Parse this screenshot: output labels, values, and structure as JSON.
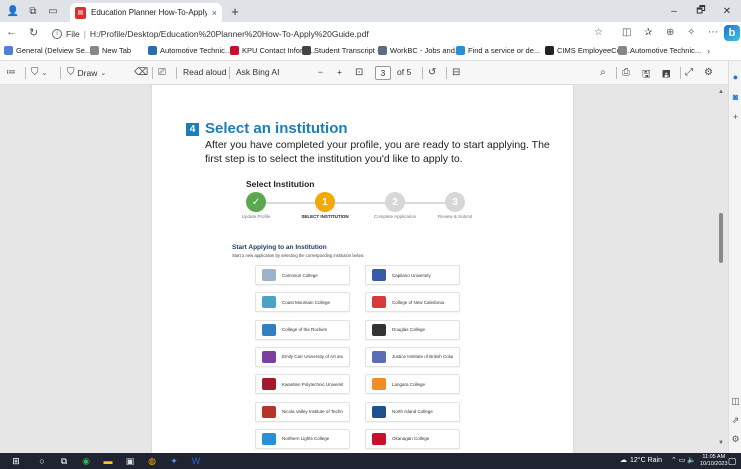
{
  "tab": {
    "title": "Education Planner How-To-Apply",
    "close": "×",
    "new": "+"
  },
  "window": {
    "minimize": "–",
    "restore": "🗗",
    "close": "✕"
  },
  "address": {
    "file_label": "File",
    "url": "H:/Profile/Desktop/Education%20Planner%20How-To-Apply%20Guide.pdf"
  },
  "favorites": [
    {
      "label": "General (Delview Se...",
      "color": "#4f7fd9"
    },
    {
      "label": "New Tab",
      "color": "#888888"
    },
    {
      "label": "Automotive Technic...",
      "color": "#2b6cb0"
    },
    {
      "label": "KPU Contact Inform...",
      "color": "#c8102e"
    },
    {
      "label": "Student Transcript -...",
      "color": "#444444"
    },
    {
      "label": "WorkBC - Jobs and...",
      "color": "#5a6d85"
    },
    {
      "label": "Find a service or de...",
      "color": "#2b8fd6"
    },
    {
      "label": "CIMS EmployeeCon...",
      "color": "#222222"
    },
    {
      "label": "Automotive Technic...",
      "color": "#888888"
    }
  ],
  "pdf_toolbar": {
    "draw": "Draw",
    "read_aloud": "Read aloud",
    "ask_bing": "Ask Bing AI",
    "zoom_out": "−",
    "zoom_in": "+",
    "page_current": "3",
    "page_of": "of 5"
  },
  "document": {
    "step_number": "4",
    "step_title": "Select an institution",
    "step_body": "After you have completed your profile, you are ready to start applying. The first step is to select the institution you'd like to apply to.",
    "select_title": "Select Institution",
    "stepper": [
      {
        "num": "✓",
        "label": "Update Profile",
        "color": "#5ba84f",
        "active": false
      },
      {
        "num": "1",
        "label": "SELECT INSTITUTION",
        "color": "#f2a900",
        "active": true
      },
      {
        "num": "2",
        "label": "Complete Application",
        "color": "#d7d7d7",
        "active": false
      },
      {
        "num": "3",
        "label": "Review & Submit",
        "color": "#d7d7d7",
        "active": false
      }
    ],
    "apply_title": "Start Applying to an Institution",
    "apply_sub": "Start a new application by selecting the corresponding institution below.",
    "institutions": [
      {
        "name": "Camosun College",
        "color": "#9ab3c9"
      },
      {
        "name": "Capilano University",
        "color": "#3a5aa8"
      },
      {
        "name": "Coast Mountain College",
        "color": "#4aa3c7"
      },
      {
        "name": "College of New Caledonia",
        "color": "#d63a3a"
      },
      {
        "name": "College of the Rockies",
        "color": "#2f7fc1"
      },
      {
        "name": "Douglas College",
        "color": "#333333"
      },
      {
        "name": "Emily Carr University of Art and Design",
        "color": "#7b3fa0"
      },
      {
        "name": "Justice Institute of British Columbia",
        "color": "#5b6db5"
      },
      {
        "name": "Kwantlen Polytechnic University",
        "color": "#a3192e"
      },
      {
        "name": "Langara College",
        "color": "#f28c28"
      },
      {
        "name": "Nicola Valley Institute of Technology",
        "color": "#b8322a"
      },
      {
        "name": "North Island College",
        "color": "#1f4f8f"
      },
      {
        "name": "Northern Lights College",
        "color": "#2b8fd6"
      },
      {
        "name": "Okanagan College",
        "color": "#c8102e"
      }
    ]
  },
  "taskbar": {
    "weather": "12°C  Rain",
    "time": "11:05 AM",
    "date": "10/10/2023"
  }
}
